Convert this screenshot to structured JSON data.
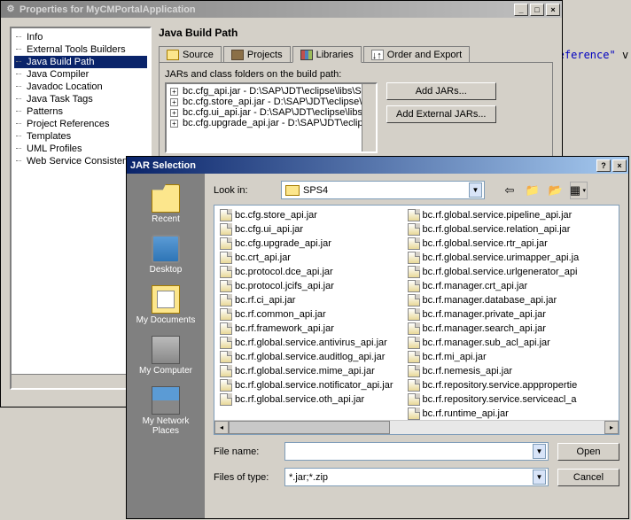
{
  "props_window": {
    "title": "Properties for MyCMPortalApplication",
    "tree": [
      "Info",
      "External Tools Builders",
      "Java Build Path",
      "Java Compiler",
      "Javadoc Location",
      "Java Task Tags",
      "Patterns",
      "Project References",
      "Templates",
      "UML Profiles",
      "Web Service Consistenc"
    ],
    "tree_selected": "Java Build Path",
    "section_title": "Java Build Path",
    "tabs": {
      "source": "Source",
      "projects": "Projects",
      "libraries": "Libraries",
      "order": "Order and Export"
    },
    "sublabel": "JARs and class folders on the build path:",
    "jars": [
      "bc.cfg_api.jar - D:\\SAP\\JDT\\eclipse\\libs\\SPS",
      "bc.cfg.store_api.jar - D:\\SAP\\JDT\\eclipse\\libs\\S",
      "bc.cfg.ui_api.jar - D:\\SAP\\JDT\\eclipse\\libs\\S",
      "bc.cfg.upgrade_api.jar - D:\\SAP\\JDT\\eclipse"
    ],
    "buttons": {
      "add_jars": "Add JARs...",
      "add_ext_jars": "Add External JARs..."
    }
  },
  "jar_dialog": {
    "title": "JAR Selection",
    "lookin_label": "Look in:",
    "lookin_value": "SPS4",
    "places": {
      "recent": "Recent",
      "desktop": "Desktop",
      "documents": "My Documents",
      "computer": "My Computer",
      "network": "My Network Places"
    },
    "files_col1": [
      "bc.cfg.store_api.jar",
      "bc.cfg.ui_api.jar",
      "bc.cfg.upgrade_api.jar",
      "bc.crt_api.jar",
      "bc.protocol.dce_api.jar",
      "bc.protocol.jcifs_api.jar",
      "bc.rf.ci_api.jar",
      "bc.rf.common_api.jar",
      "bc.rf.framework_api.jar",
      "bc.rf.global.service.antivirus_api.jar",
      "bc.rf.global.service.auditlog_api.jar",
      "bc.rf.global.service.mime_api.jar",
      "bc.rf.global.service.notificator_api.jar",
      "bc.rf.global.service.oth_api.jar"
    ],
    "files_col2": [
      "bc.rf.global.service.pipeline_api.jar",
      "bc.rf.global.service.relation_api.jar",
      "bc.rf.global.service.rtr_api.jar",
      "bc.rf.global.service.urimapper_api.ja",
      "bc.rf.global.service.urlgenerator_api",
      "bc.rf.manager.crt_api.jar",
      "bc.rf.manager.database_api.jar",
      "bc.rf.manager.private_api.jar",
      "bc.rf.manager.search_api.jar",
      "bc.rf.manager.sub_acl_api.jar",
      "bc.rf.mi_api.jar",
      "bc.rf.nemesis_api.jar",
      "bc.rf.repository.service.apppropertie",
      "bc.rf.repository.service.serviceacl_a",
      "bc.rf.runtime_api.jar"
    ],
    "filename_label": "File name:",
    "filename_value": "",
    "filetype_label": "Files of type:",
    "filetype_value": "*.jar;*.zip",
    "open_btn": "Open",
    "cancel_btn": "Cancel"
  },
  "code_snippet": "ngReference\""
}
